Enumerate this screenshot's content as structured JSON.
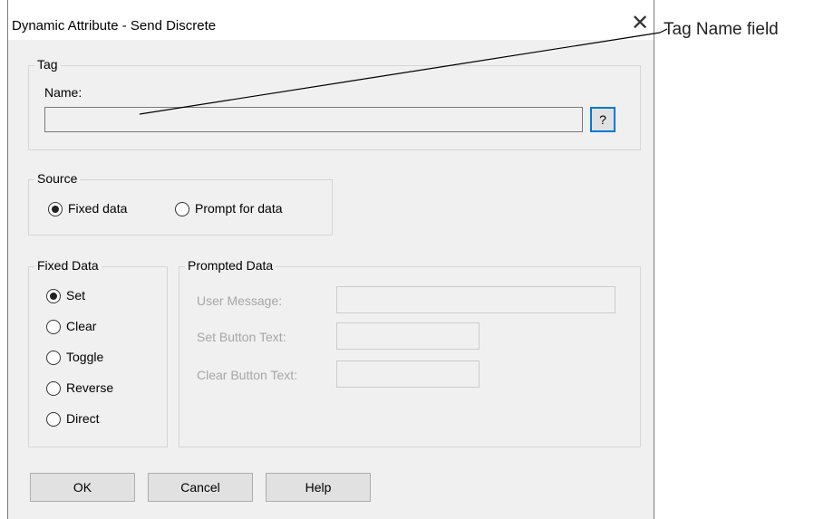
{
  "window": {
    "title": "Dynamic Attribute - Send Discrete",
    "close_glyph": "✕"
  },
  "tag": {
    "group_label": "Tag",
    "name_label": "Name:",
    "name_value": "",
    "browse_label": "?"
  },
  "source": {
    "group_label": "Source",
    "options": [
      {
        "label": "Fixed data",
        "selected": true
      },
      {
        "label": "Prompt for data",
        "selected": false
      }
    ]
  },
  "fixed_data": {
    "group_label": "Fixed Data",
    "options": [
      {
        "label": "Set",
        "selected": true
      },
      {
        "label": "Clear",
        "selected": false
      },
      {
        "label": "Toggle",
        "selected": false
      },
      {
        "label": "Reverse",
        "selected": false
      },
      {
        "label": "Direct",
        "selected": false
      }
    ]
  },
  "prompted_data": {
    "group_label": "Prompted Data",
    "user_message_label": "User Message:",
    "set_button_text_label": "Set Button Text:",
    "clear_button_text_label": "Clear Button Text:",
    "user_message_value": "",
    "set_button_text_value": "",
    "clear_button_text_value": ""
  },
  "buttons": {
    "ok": "OK",
    "cancel": "Cancel",
    "help": "Help"
  },
  "annotation": {
    "text": "Tag Name field"
  }
}
